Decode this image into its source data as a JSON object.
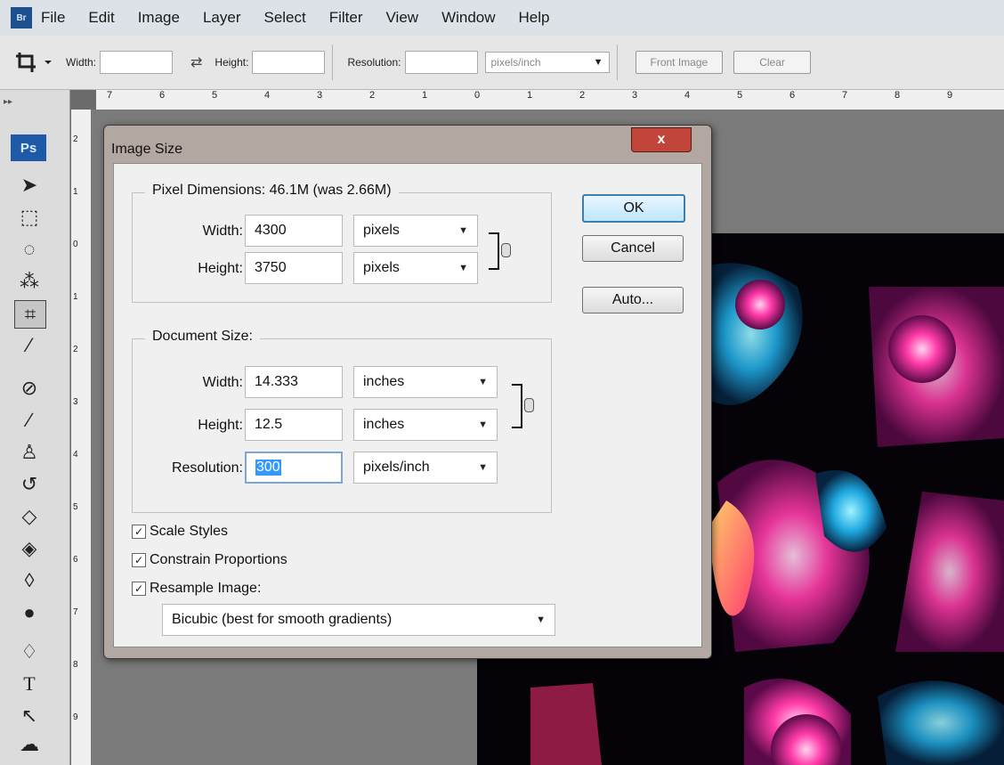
{
  "menubar": {
    "logo_text": "Br",
    "items": [
      "File",
      "Edit",
      "Image",
      "Layer",
      "Select",
      "Filter",
      "View",
      "Window",
      "Help"
    ]
  },
  "options_bar": {
    "width_label": "Width:",
    "height_label": "Height:",
    "resolution_label": "Resolution:",
    "resolution_unit": "pixels/inch",
    "front_image_label": "Front Image",
    "clear_label": "Clear"
  },
  "ruler": {
    "h_ticks": [
      "7",
      "6",
      "5",
      "4",
      "3",
      "2",
      "1",
      "0",
      "1",
      "2",
      "3",
      "4",
      "5",
      "6",
      "7",
      "8",
      "9"
    ],
    "v_ticks": [
      "2",
      "1",
      "0",
      "1",
      "2",
      "3",
      "4",
      "5",
      "6",
      "7",
      "8",
      "9"
    ]
  },
  "toolbox": {
    "logo_text": "Ps",
    "tools": [
      "move-tool-icon",
      "marquee-tool-icon",
      "lasso-tool-icon",
      "magic-wand-icon",
      "crop-tool-icon",
      "eyedropper-icon",
      "healing-brush-icon",
      "brush-icon",
      "clone-stamp-icon",
      "history-brush-icon",
      "eraser-icon",
      "paint-bucket-icon",
      "blur-icon",
      "dodge-icon",
      "pen-icon",
      "type-tool-icon",
      "path-selection-icon",
      "shape-tool-icon"
    ]
  },
  "dialog": {
    "title": "Image Size",
    "close_label": "x",
    "pixel_dimensions": {
      "legend": "Pixel Dimensions:  46.1M (was 2.66M)",
      "width_label": "Width:",
      "width_value": "4300",
      "width_unit": "pixels",
      "height_label": "Height:",
      "height_value": "3750",
      "height_unit": "pixels"
    },
    "document_size": {
      "legend": "Document Size:",
      "width_label": "Width:",
      "width_value": "14.333",
      "width_unit": "inches",
      "height_label": "Height:",
      "height_value": "12.5",
      "height_unit": "inches",
      "resolution_label": "Resolution:",
      "resolution_value": "300",
      "resolution_unit": "pixels/inch"
    },
    "checkboxes": {
      "scale_styles": "Scale Styles",
      "constrain_proportions": "Constrain Proportions",
      "resample_image": "Resample Image:"
    },
    "resample_method": "Bicubic (best for smooth gradients)",
    "buttons": {
      "ok": "OK",
      "cancel": "Cancel",
      "auto": "Auto..."
    }
  }
}
